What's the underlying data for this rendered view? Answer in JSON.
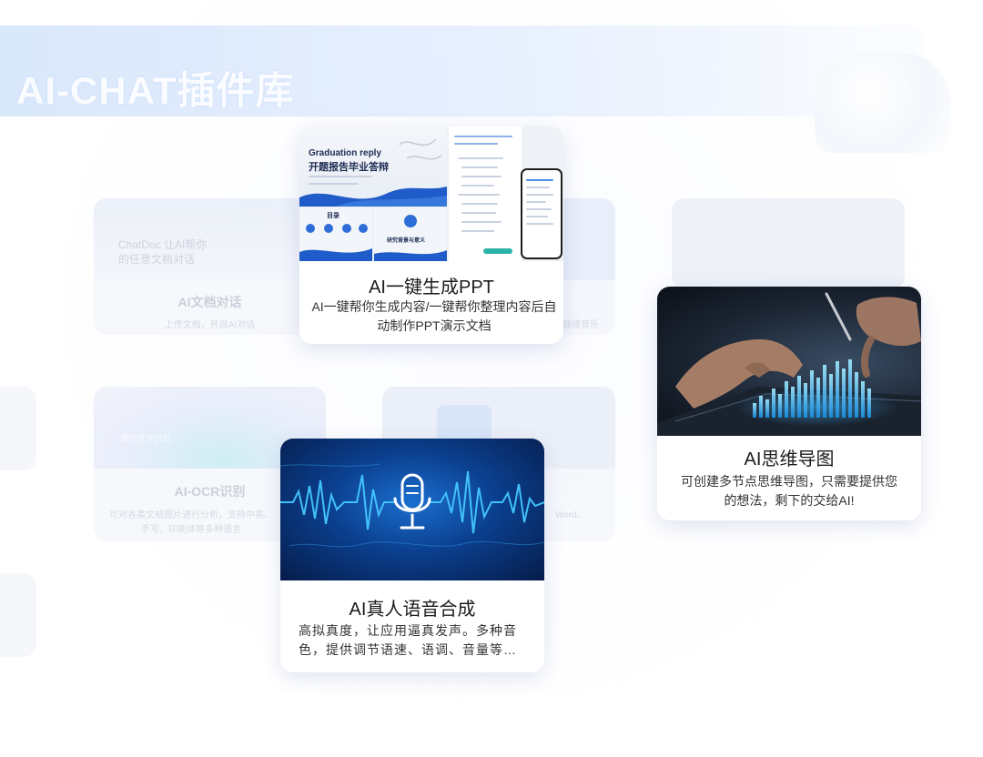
{
  "banner": {
    "title": "AI-CHAT插件库"
  },
  "background_cards": [
    {
      "title": "AI文档对话",
      "desc": "上传文档，开启AI对话",
      "thumb_text_1": "ChatDoc 让AI帮你",
      "thumb_text_2": "的任意文档对话"
    },
    {
      "title": "",
      "desc": "翻译音乐"
    },
    {
      "title": "AI-OCR识别",
      "desc": "可对各类文档图片进行分析，支持中英、手写、印刷体等多种语言",
      "thumb_text": "图片文字识别"
    },
    {
      "title": "",
      "desc": "Word、"
    }
  ],
  "featured_cards": {
    "ppt": {
      "title": "AI一键生成PPT",
      "desc": "AI一键帮你生成内容/一键帮你整理内容后自动制作PPT演示文档",
      "slide_title_en": "Graduation reply",
      "slide_title_cn": "开题报告毕业答辩",
      "slide_section": "目录",
      "slide_sub": "研究背景与意义"
    },
    "mindmap": {
      "title": "AI思维导图",
      "desc": "可创建多节点思维导图，只需要提供您的想法，剩下的交给AI!"
    },
    "voice": {
      "title": "AI真人语音合成",
      "desc": "高拟真度，让应用逼真发声。多种音色，提供调节语速、语调、音量等…"
    }
  },
  "icons": [
    "microphone-icon",
    "waveform-graphic",
    "bar-chart-graphic"
  ],
  "colors": {
    "accent": "#1e5fd6",
    "banner": "#cfe0fb",
    "voice_bg": "#0b3f8e",
    "wave": "#45c8ff"
  }
}
